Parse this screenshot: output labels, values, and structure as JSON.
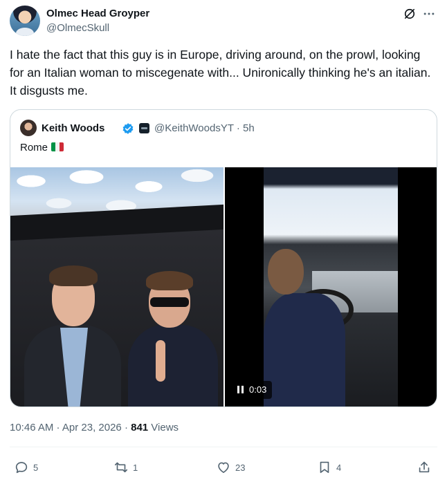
{
  "post": {
    "display_name": "Olmec Head Groyper",
    "handle": "@OlmecSkull",
    "text": "I hate the fact that this guy is in Europe, driving around, on the prowl, looking for an Italian woman to miscegenate with... Unironically thinking he's an italian. It disgusts me.",
    "timestamp": "10:46 AM · Apr 23, 2026 · ",
    "views_count": "841",
    "views_label": " Views"
  },
  "quote": {
    "display_name": "Keith Woods",
    "handle_time": "@KeithWoodsYT · 5h",
    "text": "Rome",
    "flag_icon": "italy-flag-icon",
    "video_time": "0:03"
  },
  "actions": {
    "replies": "5",
    "reposts": "1",
    "likes": "23",
    "bookmarks": "4"
  },
  "colors": {
    "text_primary": "#0f1419",
    "text_secondary": "#536471",
    "verified_blue": "#1d9bf0",
    "border": "#cfd9de"
  }
}
